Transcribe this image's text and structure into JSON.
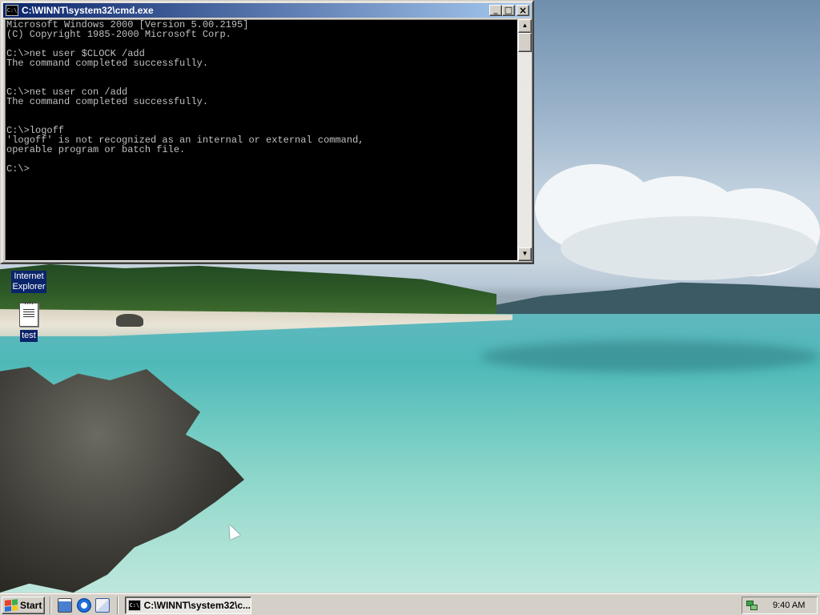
{
  "window": {
    "title": "C:\\WINNT\\system32\\cmd.exe",
    "icon_text": "C:\\",
    "minimize_glyph": "_",
    "maximize_glyph": "□",
    "close_glyph": "×"
  },
  "console": {
    "lines": [
      "Microsoft Windows 2000 [Version 5.00.2195]",
      "(C) Copyright 1985-2000 Microsoft Corp.",
      "",
      "C:\\>net user $CLOCK /add",
      "The command completed successfully.",
      "",
      "",
      "C:\\>net user con /add",
      "The command completed successfully.",
      "",
      "",
      "C:\\>logoff",
      "'logoff' is not recognized as an internal or external command,",
      "operable program or batch file.",
      "",
      "C:\\>"
    ],
    "text_color": "#c0c0c0",
    "background": "#000000"
  },
  "desktop": {
    "icons": [
      {
        "name": "internet-explorer",
        "label": "Internet\nExplorer"
      },
      {
        "name": "test",
        "label": "test"
      }
    ]
  },
  "taskbar": {
    "start_label": "Start",
    "task_label": "C:\\WINNT\\system32\\c...",
    "clock": "9:40 AM",
    "quicklaunch": [
      "show-desktop-icon",
      "internet-explorer-icon",
      "outlook-express-icon"
    ]
  },
  "colors": {
    "title_active_start": "#0a246a",
    "title_active_end": "#a6caf0",
    "chrome": "#d4d0c8",
    "selection": "#0a246a"
  }
}
